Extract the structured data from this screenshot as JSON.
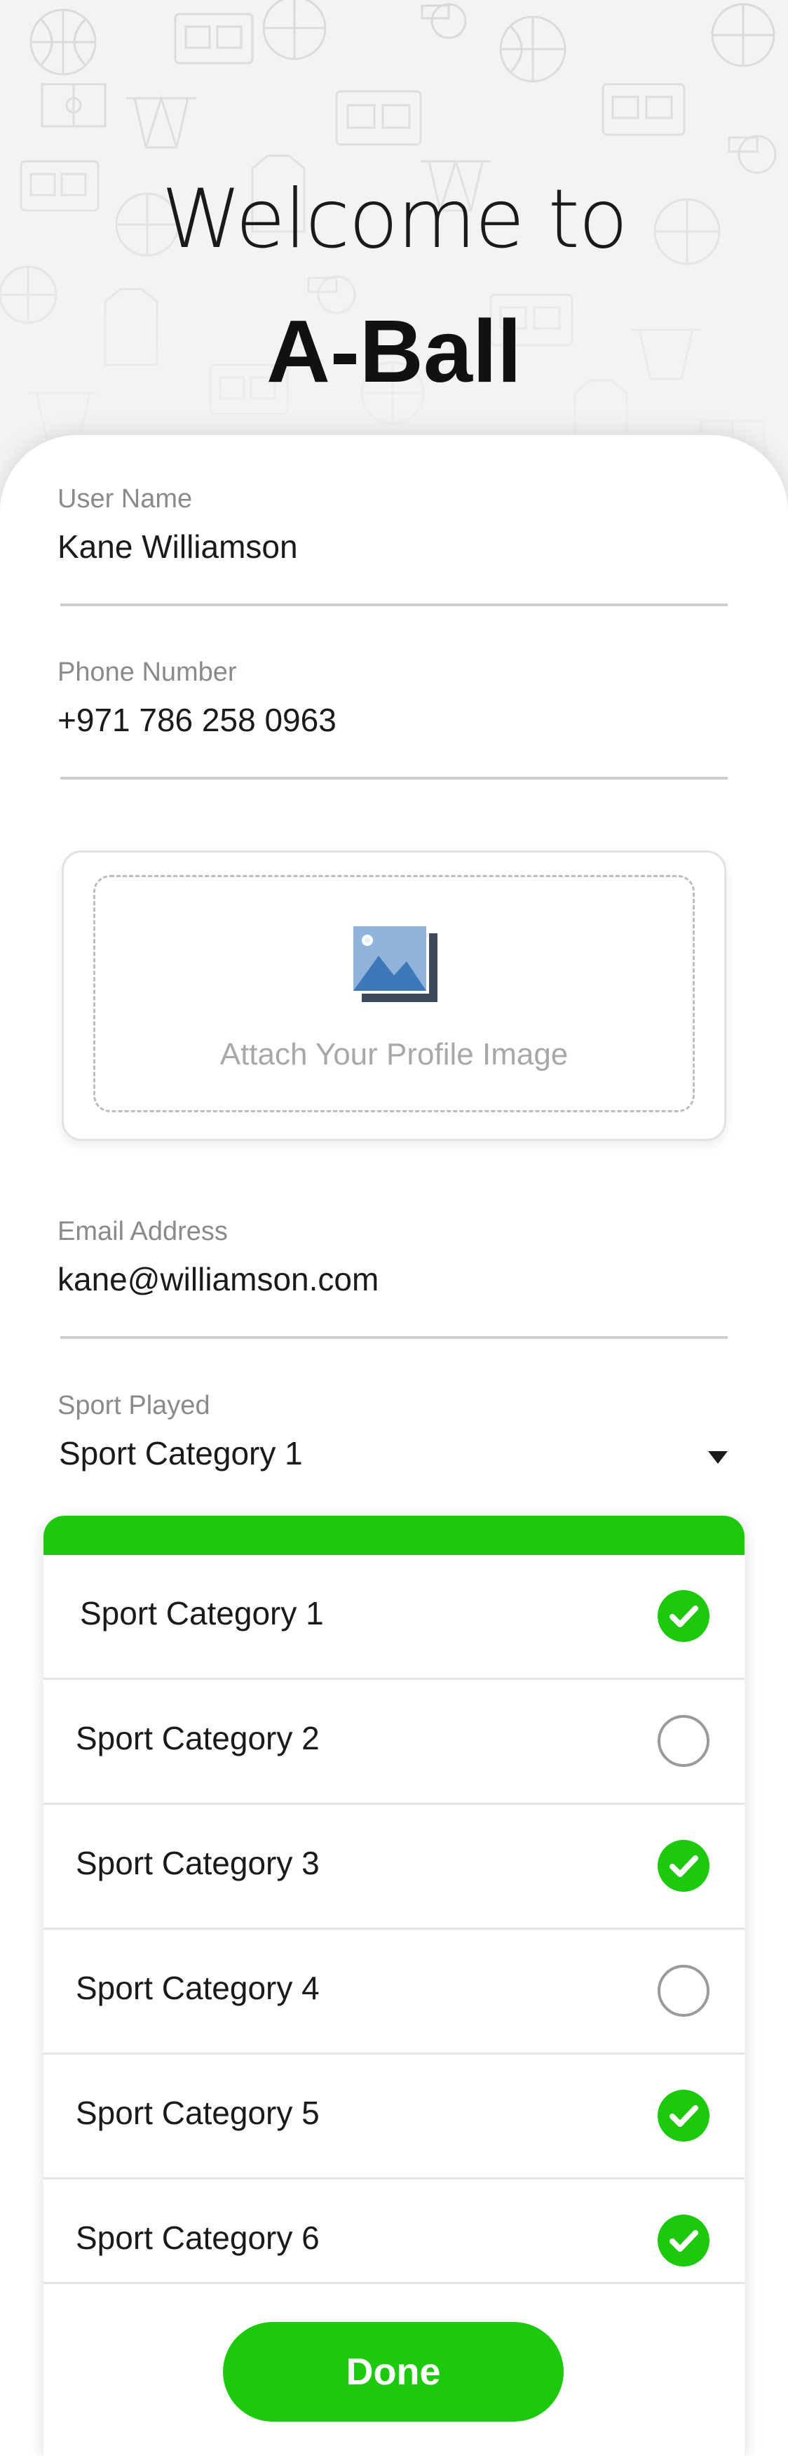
{
  "header": {
    "welcome": "Welcome to",
    "brand": "A-Ball"
  },
  "form": {
    "username": {
      "label": "User Name",
      "value": "Kane Williamson"
    },
    "phone": {
      "label": "Phone Number",
      "value": "+971 786 258 0963"
    },
    "attach": {
      "label": "Attach Your Profile Image",
      "icon": "image-icon"
    },
    "email": {
      "label": "Email Address",
      "value": "kane@williamson.com"
    },
    "sport": {
      "label": "Sport Played",
      "value": "Sport Category 1"
    }
  },
  "sport_list": {
    "items": [
      {
        "label": "Sport Category 1",
        "checked": true
      },
      {
        "label": "Sport Category 2",
        "checked": false
      },
      {
        "label": "Sport Category 3",
        "checked": true
      },
      {
        "label": "Sport Category 4",
        "checked": false
      },
      {
        "label": "Sport Category 5",
        "checked": true
      },
      {
        "label": "Sport Category 6",
        "checked": true
      }
    ],
    "done_label": "Done"
  },
  "colors": {
    "accent": "#1dc90c",
    "background": "#f3f3f3",
    "card": "#ffffff",
    "label": "#8a8a8a"
  }
}
